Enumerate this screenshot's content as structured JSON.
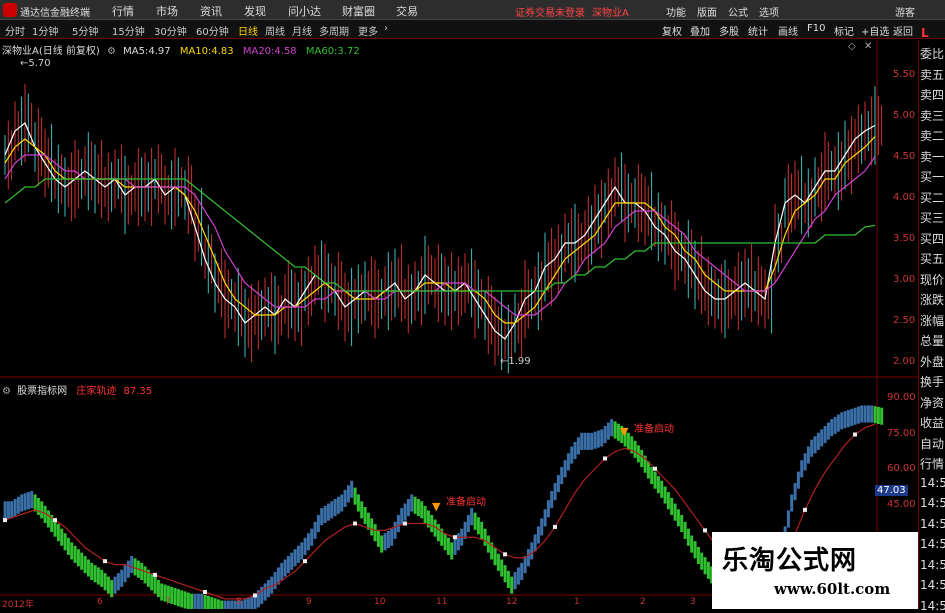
{
  "titlebar": {
    "app_name": "通达信金融终端",
    "menus": [
      "行情",
      "市场",
      "资讯",
      "发现",
      "问小达",
      "财富圈",
      "交易"
    ],
    "notice": "证券交易未登录",
    "stock": "深物业A",
    "right_menus": [
      "功能",
      "版面",
      "公式",
      "选项"
    ],
    "user": "游客"
  },
  "toolbar": {
    "periods": [
      "分时",
      "1分钟",
      "5分钟",
      "15分钟",
      "30分钟",
      "60分钟",
      "日线",
      "周线",
      "月线",
      "多周期",
      "更多"
    ],
    "active_period": "日线",
    "right_tools": [
      "复权",
      "叠加",
      "多股",
      "统计",
      "画线",
      "F10",
      "标记",
      "+自选",
      "返回"
    ]
  },
  "price_chart": {
    "title": "深物业A(日线 前复权)",
    "ma": [
      {
        "label": "MA5:",
        "value": "4.97",
        "color": "#ffffff"
      },
      {
        "label": "MA10:",
        "value": "4.83",
        "color": "#ffd700"
      },
      {
        "label": "MA20:",
        "value": "4.58",
        "color": "#d040d0"
      },
      {
        "label": "MA60:",
        "value": "3.72",
        "color": "#30c030"
      }
    ],
    "high_label": "5.70",
    "low_label": "1.99",
    "y_ticks": [
      "5.50",
      "5.00",
      "4.50",
      "4.00",
      "3.50",
      "3.00",
      "2.50",
      "2.00"
    ]
  },
  "indicator": {
    "name": "股票指标网",
    "title": "庄家轨迹",
    "value": "87.35",
    "y_ticks": [
      "90.00",
      "75.00",
      "60.00",
      "45.00"
    ],
    "current_value": "47.03",
    "annotations": [
      "准备启动",
      "准备启动"
    ]
  },
  "x_labels": [
    "2012年",
    "6",
    "7",
    "8",
    "9",
    "10",
    "11",
    "12",
    "1",
    "2",
    "3"
  ],
  "right_panel": {
    "top": "L",
    "items": [
      "委比",
      "卖五",
      "卖四",
      "卖三",
      "卖二",
      "卖一",
      "买一",
      "买二",
      "买三",
      "买四",
      "买五",
      "现价",
      "涨跌",
      "涨幅",
      "总量",
      "外盘",
      "换手",
      "净资",
      "收益",
      "自动",
      "行情",
      "14:5",
      "14:5",
      "14:5",
      "14:5",
      "14:5",
      "14:5",
      "14:5"
    ]
  },
  "watermark": {
    "text": "乐淘公式网",
    "url": "www.60lt.com"
  },
  "chart_data": [
    {
      "type": "line",
      "title": "深物业A(日线 前复权)",
      "ylim": [
        1.85,
        5.85
      ],
      "y_ticks": [
        5.5,
        5.0,
        4.5,
        4.0,
        3.5,
        3.0,
        2.5,
        2.0
      ],
      "x": [
        0,
        10,
        20,
        30,
        40,
        50,
        60,
        70,
        80,
        90,
        100,
        110,
        120,
        130,
        140,
        150,
        160,
        170,
        180,
        190,
        200,
        210,
        220,
        230,
        240,
        250,
        260,
        270,
        280,
        290,
        300,
        310,
        320,
        330,
        340,
        350,
        360,
        370,
        380,
        390,
        400,
        410,
        420,
        430,
        440,
        450,
        460,
        470,
        480,
        490,
        500,
        510,
        520,
        530,
        540,
        550,
        560,
        570,
        580,
        590,
        600,
        610,
        620,
        630,
        640,
        650,
        660,
        670,
        680,
        690,
        700,
        710,
        720,
        730,
        740,
        750,
        760,
        770,
        780,
        790,
        800,
        810,
        820,
        830,
        840,
        850,
        860,
        870
      ],
      "series": [
        {
          "name": "MA5",
          "color": "#ffffff",
          "values": [
            4.6,
            4.9,
            5.0,
            4.7,
            4.5,
            4.3,
            4.2,
            4.3,
            4.4,
            4.3,
            4.2,
            4.3,
            4.1,
            4.2,
            4.2,
            4.3,
            4.1,
            4.2,
            4.1,
            3.7,
            3.3,
            3.0,
            2.8,
            2.7,
            2.5,
            2.6,
            2.7,
            2.6,
            2.8,
            2.7,
            2.9,
            3.1,
            3.0,
            2.9,
            2.7,
            2.8,
            2.9,
            2.8,
            2.9,
            3.0,
            2.8,
            2.9,
            3.1,
            3.0,
            2.9,
            2.9,
            3.0,
            2.8,
            2.6,
            2.4,
            2.3,
            2.5,
            2.8,
            2.9,
            3.2,
            3.3,
            3.5,
            3.5,
            3.6,
            3.8,
            4.0,
            4.2,
            4.0,
            4.0,
            3.9,
            3.7,
            3.6,
            3.4,
            3.3,
            3.1,
            2.9,
            2.8,
            2.8,
            2.9,
            3.0,
            2.9,
            2.8,
            3.5,
            4.0,
            4.1,
            4.0,
            4.2,
            4.4,
            4.4,
            4.6,
            4.8,
            4.9,
            4.97
          ]
        },
        {
          "name": "MA10",
          "color": "#ffd700",
          "values": [
            4.5,
            4.7,
            4.8,
            4.7,
            4.6,
            4.4,
            4.3,
            4.3,
            4.3,
            4.3,
            4.3,
            4.3,
            4.2,
            4.2,
            4.2,
            4.2,
            4.2,
            4.2,
            4.1,
            3.9,
            3.6,
            3.3,
            3.0,
            2.8,
            2.7,
            2.6,
            2.6,
            2.6,
            2.7,
            2.7,
            2.8,
            2.9,
            3.0,
            2.9,
            2.9,
            2.8,
            2.8,
            2.8,
            2.9,
            2.9,
            2.9,
            2.9,
            3.0,
            3.0,
            3.0,
            2.9,
            2.9,
            2.9,
            2.8,
            2.6,
            2.5,
            2.5,
            2.6,
            2.7,
            2.9,
            3.1,
            3.3,
            3.4,
            3.5,
            3.6,
            3.8,
            4.0,
            4.0,
            4.0,
            4.0,
            3.9,
            3.7,
            3.6,
            3.4,
            3.3,
            3.1,
            3.0,
            2.9,
            2.9,
            2.9,
            2.9,
            2.9,
            3.2,
            3.6,
            3.9,
            4.0,
            4.1,
            4.3,
            4.3,
            4.5,
            4.6,
            4.7,
            4.83
          ]
        },
        {
          "name": "MA20",
          "color": "#d040d0",
          "values": [
            4.3,
            4.5,
            4.6,
            4.6,
            4.6,
            4.5,
            4.4,
            4.4,
            4.3,
            4.3,
            4.3,
            4.3,
            4.3,
            4.2,
            4.2,
            4.2,
            4.2,
            4.2,
            4.2,
            4.1,
            3.9,
            3.7,
            3.4,
            3.2,
            3.0,
            2.9,
            2.8,
            2.7,
            2.7,
            2.7,
            2.7,
            2.8,
            2.8,
            2.9,
            2.9,
            2.9,
            2.9,
            2.8,
            2.8,
            2.9,
            2.9,
            2.9,
            2.9,
            2.9,
            3.0,
            3.0,
            3.0,
            2.9,
            2.9,
            2.8,
            2.7,
            2.6,
            2.6,
            2.6,
            2.7,
            2.8,
            3.0,
            3.1,
            3.3,
            3.4,
            3.5,
            3.7,
            3.8,
            3.9,
            3.9,
            3.9,
            3.8,
            3.7,
            3.6,
            3.4,
            3.3,
            3.2,
            3.1,
            3.0,
            2.9,
            2.9,
            2.9,
            3.0,
            3.2,
            3.4,
            3.6,
            3.8,
            3.9,
            4.1,
            4.2,
            4.3,
            4.4,
            4.58
          ]
        },
        {
          "name": "MA60",
          "color": "#30c030",
          "values": [
            4.0,
            4.1,
            4.2,
            4.2,
            4.3,
            4.3,
            4.3,
            4.3,
            4.3,
            4.3,
            4.3,
            4.3,
            4.3,
            4.3,
            4.3,
            4.3,
            4.3,
            4.3,
            4.3,
            4.2,
            4.1,
            4.0,
            3.9,
            3.8,
            3.7,
            3.6,
            3.5,
            3.4,
            3.3,
            3.2,
            3.2,
            3.1,
            3.0,
            3.0,
            2.9,
            2.9,
            2.9,
            2.9,
            2.9,
            2.9,
            2.9,
            2.9,
            2.9,
            2.9,
            2.9,
            2.9,
            2.9,
            2.9,
            2.9,
            2.9,
            2.9,
            2.9,
            2.9,
            2.9,
            2.9,
            3.0,
            3.0,
            3.1,
            3.1,
            3.2,
            3.2,
            3.3,
            3.3,
            3.4,
            3.4,
            3.5,
            3.5,
            3.5,
            3.5,
            3.5,
            3.5,
            3.5,
            3.5,
            3.5,
            3.5,
            3.5,
            3.5,
            3.5,
            3.5,
            3.5,
            3.5,
            3.5,
            3.6,
            3.6,
            3.6,
            3.6,
            3.7,
            3.72
          ]
        }
      ]
    },
    {
      "type": "line",
      "title": "庄家轨迹",
      "ylim": [
        36,
        95
      ],
      "y_ticks": [
        90,
        75,
        60,
        45
      ],
      "x": [
        0,
        10,
        20,
        30,
        40,
        50,
        60,
        70,
        80,
        90,
        100,
        110,
        120,
        130,
        140,
        150,
        160,
        170,
        180,
        190,
        200,
        210,
        220,
        230,
        240,
        250,
        260,
        270,
        280,
        290,
        300,
        310,
        320,
        330,
        340,
        350,
        360,
        370,
        380,
        390,
        400,
        410,
        420,
        430,
        440,
        450,
        460,
        470,
        480,
        490,
        500,
        510,
        520,
        530,
        540,
        550,
        560,
        570,
        580,
        590,
        600,
        610,
        620,
        630,
        640,
        650,
        660,
        670,
        680,
        690,
        700,
        710,
        720,
        730,
        740,
        750,
        760,
        770,
        780,
        790,
        800,
        810,
        820,
        830,
        840,
        850,
        860,
        870
      ],
      "series": [
        {
          "name": "庄家轨迹",
          "color": "#30d030",
          "values": [
            60,
            62,
            63,
            60,
            56,
            52,
            48,
            45,
            42,
            40,
            37,
            40,
            44,
            42,
            39,
            36,
            35,
            34,
            33,
            33,
            32,
            31,
            31,
            31,
            32,
            35,
            38,
            42,
            45,
            48,
            52,
            58,
            60,
            62,
            66,
            60,
            55,
            50,
            52,
            58,
            62,
            60,
            56,
            52,
            48,
            52,
            58,
            54,
            48,
            43,
            38,
            42,
            48,
            55,
            63,
            70,
            76,
            80,
            80,
            81,
            84,
            82,
            79,
            75,
            70,
            66,
            61,
            56,
            50,
            45,
            41,
            37,
            34,
            32,
            31,
            30,
            30,
            48,
            62,
            72,
            78,
            81,
            84,
            86,
            87,
            88,
            88,
            87.35
          ]
        },
        {
          "name": "",
          "color": "#b02020",
          "values": [
            57,
            58,
            59,
            60,
            59,
            57,
            55,
            52,
            49,
            47,
            45,
            44,
            44,
            43,
            42,
            41,
            40,
            39,
            38,
            37,
            36,
            35,
            34,
            34,
            34,
            35,
            37,
            38,
            40,
            42,
            45,
            48,
            51,
            53,
            55,
            56,
            55,
            54,
            54,
            55,
            56,
            56,
            56,
            55,
            53,
            52,
            52,
            52,
            51,
            49,
            47,
            46,
            46,
            48,
            51,
            55,
            60,
            65,
            69,
            72,
            75,
            77,
            78,
            77,
            75,
            72,
            69,
            66,
            62,
            58,
            54,
            50,
            47,
            44,
            41,
            39,
            38,
            40,
            46,
            53,
            60,
            66,
            71,
            75,
            79,
            82,
            84,
            85
          ]
        }
      ]
    }
  ]
}
